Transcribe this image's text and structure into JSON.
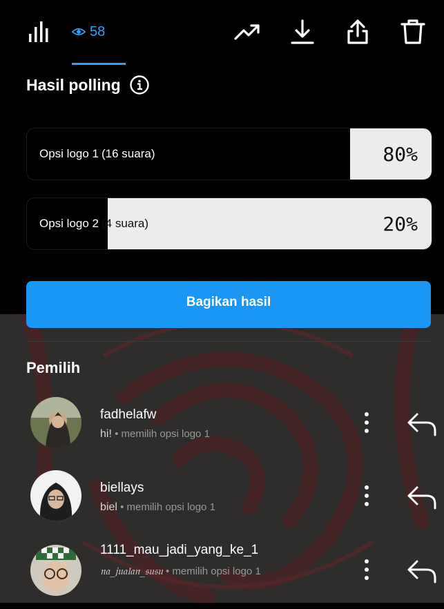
{
  "topbar": {
    "stats_icon": "bar-chart-icon",
    "viewers_icon": "eye-icon",
    "viewers_count": "58",
    "actions": [
      {
        "name": "trending-icon"
      },
      {
        "name": "download-icon"
      },
      {
        "name": "share-icon"
      },
      {
        "name": "trash-icon"
      }
    ],
    "accent_color": "#2fa3f7"
  },
  "poll": {
    "title": "Hasil polling",
    "info_icon": "info-icon",
    "options": [
      {
        "label": "Opsi logo 1",
        "votes": "(16 suara)",
        "percent_text": "80%",
        "percent": 80
      },
      {
        "label": "Opsi logo 2",
        "votes": "(4 suara)",
        "percent_text": "20%",
        "percent": 20
      }
    ],
    "share_button": "Bagikan hasil",
    "button_color": "#1a97f5"
  },
  "voters": {
    "title": "Pemilih",
    "list": [
      {
        "username": "fadhelafw",
        "nickname": "hi!",
        "separator": "•",
        "action": "memilih opsi logo 1"
      },
      {
        "username": "biellays",
        "nickname": "biel",
        "separator": "•",
        "action": "memilih opsi logo 1"
      },
      {
        "username": "1111_mau_jadi_yang_ke_1",
        "nickname": "𝔫𝔞_𝔧𝔲𝔞𝔩𝔞𝔫_𝔰𝔲𝔰𝔲",
        "separator": "•",
        "action": "memilih opsi logo 1"
      }
    ]
  }
}
